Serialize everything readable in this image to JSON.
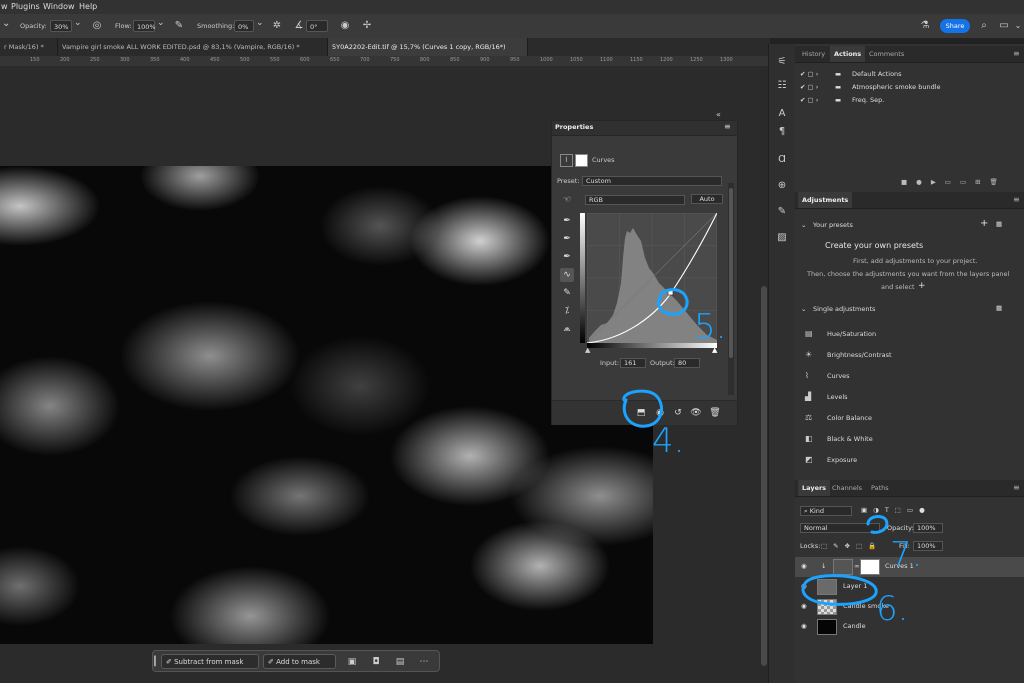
{
  "menubar": {
    "items": [
      "w",
      "Plugins",
      "Window",
      "Help"
    ]
  },
  "options": {
    "opacity_label": "Opacity:",
    "opacity_value": "30%",
    "flow_label": "Flow:",
    "flow_value": "100%",
    "smoothing_label": "Smoothing:",
    "smoothing_value": "0%",
    "angle_value": "0°",
    "share_label": "Share"
  },
  "tabs": [
    {
      "label": "r Mask/16) *"
    },
    {
      "label": "Vampire girl smoke ALL WORK EDITED.psd @ 83,1% (Vampire, RGB/16) *"
    },
    {
      "label": "5Y0A2202-Edit.tif @ 15,7% (Curves 1 copy, RGB/16*)"
    }
  ],
  "ruler_ticks": [
    "150",
    "200",
    "250",
    "300",
    "350",
    "400",
    "450",
    "500",
    "550",
    "600",
    "650",
    "700",
    "750",
    "800",
    "850",
    "900",
    "950",
    "1000",
    "1050",
    "1100",
    "1150",
    "1200",
    "1250",
    "1300"
  ],
  "taskbar": {
    "subtract_label": "Subtract from mask",
    "add_label": "Add to mask"
  },
  "properties": {
    "tab_label": "Properties",
    "title": "Curves",
    "preset_label": "Preset:",
    "preset_value": "Custom",
    "channel_value": "RGB",
    "auto_label": "Auto",
    "input_label": "Input:",
    "input_value": "161",
    "output_label": "Output:",
    "output_value": "80"
  },
  "actions_panel": {
    "tabs": [
      "History",
      "Actions",
      "Comments"
    ],
    "active_tab": "Actions",
    "items": [
      "Default Actions",
      "Atmospheric smoke bundle",
      "Freq. Sep."
    ]
  },
  "adjustments_panel": {
    "tab": "Adjustments",
    "your_presets": "Your presets",
    "create_title": "Create your own presets",
    "create_line1": "First, add adjustments to your project.",
    "create_line2": "Then, choose the adjustments you want from the layers panel",
    "create_line3": "and select",
    "single_adjustments": "Single adjustments",
    "items": [
      "Hue/Saturation",
      "Brightness/Contrast",
      "Curves",
      "Levels",
      "Color Balance",
      "Black & White",
      "Exposure"
    ]
  },
  "layers_panel": {
    "tabs": [
      "Layers",
      "Channels",
      "Paths"
    ],
    "active_tab": "Layers",
    "kind_label": "Kind",
    "blend_mode": "Normal",
    "opacity_label": "Opacity:",
    "opacity_value": "100%",
    "locks_label": "Locks:",
    "fill_label": "Fill:",
    "fill_value": "100%",
    "layers": [
      "Curves 1",
      "Layer 1",
      "Candle smoke",
      "Candle"
    ]
  },
  "annotations": [
    "4.",
    "5.",
    "6.",
    "7."
  ],
  "colors": {
    "accent": "#1473e6",
    "annotation": "#1aa3ff"
  },
  "icons": [
    "brush-icon",
    "airbrush-icon",
    "gear-icon",
    "angle-icon",
    "pressure-icon",
    "symmetry-icon",
    "flask-icon",
    "search-icon",
    "window-icon",
    "mask-icon",
    "curves-icon",
    "eyedropper-icon",
    "hand-icon",
    "eye-icon",
    "trash-icon",
    "reset-icon",
    "clip-icon"
  ]
}
